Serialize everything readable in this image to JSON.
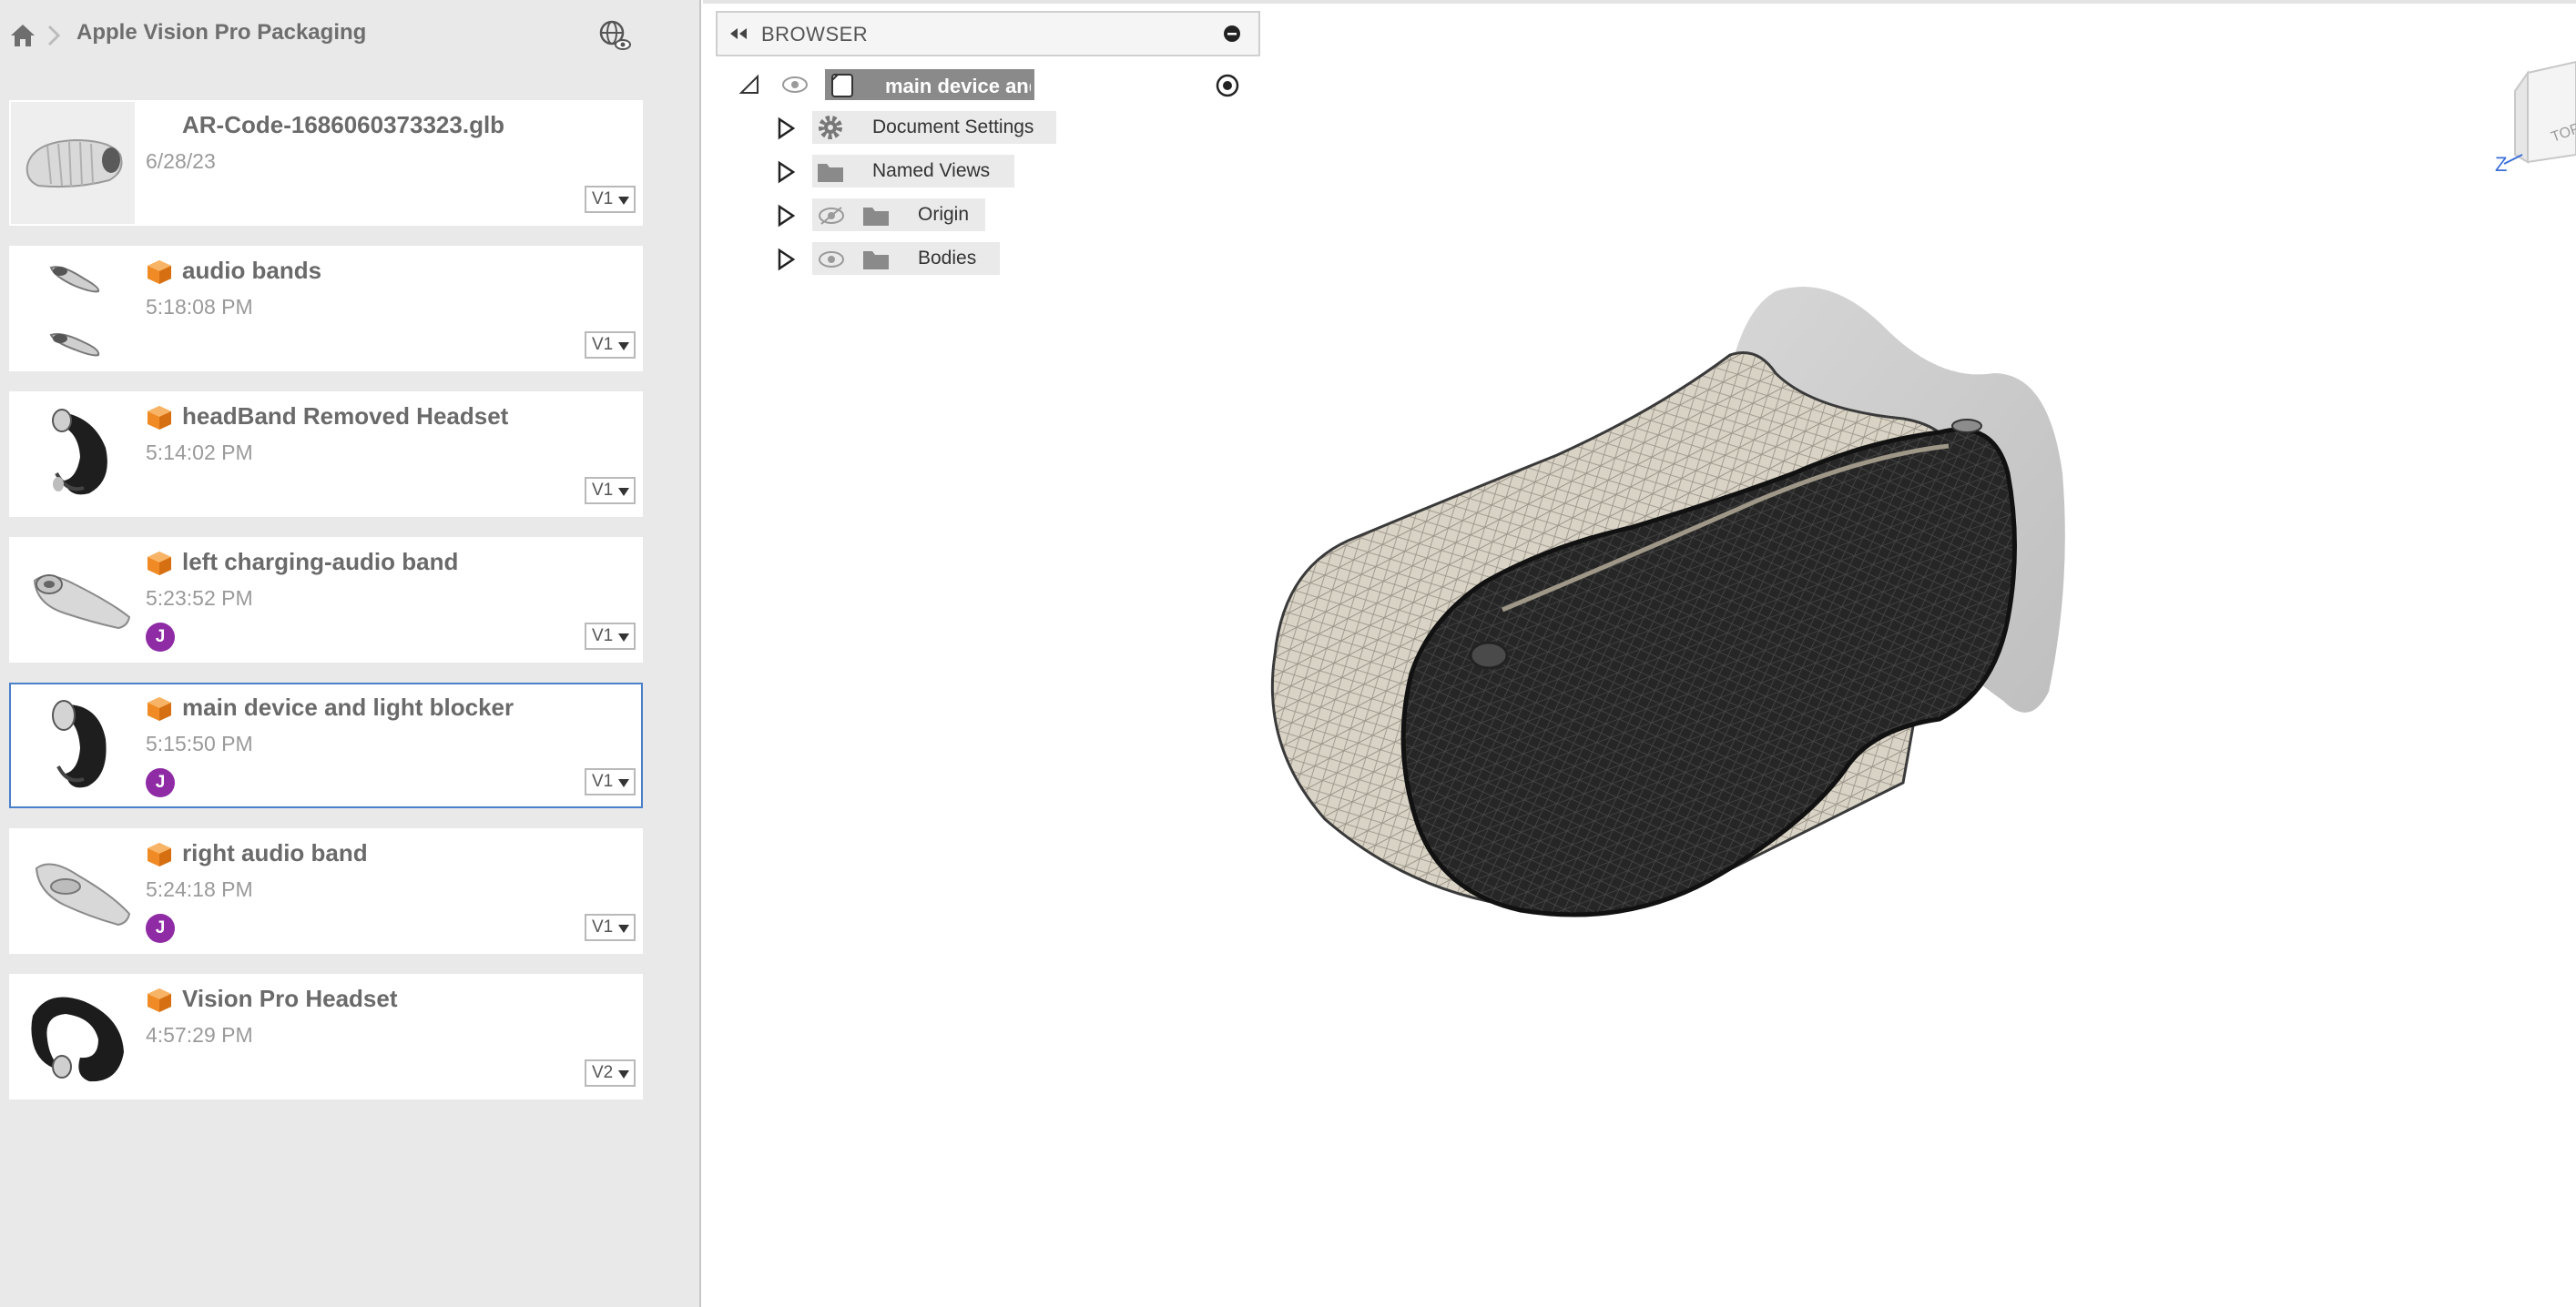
{
  "breadcrumb": {
    "title": "Apple Vision Pro Packaging"
  },
  "files": [
    {
      "name": "AR-Code-1686060373323.glb",
      "time": "6/28/23",
      "version": "V1",
      "has_avatar": false,
      "icon": "none"
    },
    {
      "name": "audio bands",
      "time": "5:18:08 PM",
      "version": "V1",
      "has_avatar": false,
      "icon": "cube-icon"
    },
    {
      "name": "headBand Removed Headset",
      "time": "5:14:02 PM",
      "version": "V1",
      "has_avatar": false,
      "icon": "cube-icon"
    },
    {
      "name": "left charging-audio band",
      "time": "5:23:52 PM",
      "version": "V1",
      "has_avatar": true,
      "avatar": "J",
      "icon": "cube-icon"
    },
    {
      "name": "main device and light blocker",
      "time": "5:15:50 PM",
      "version": "V1",
      "has_avatar": true,
      "avatar": "J",
      "icon": "cube-icon",
      "selected": true
    },
    {
      "name": "right audio band",
      "time": "5:24:18 PM",
      "version": "V1",
      "has_avatar": true,
      "avatar": "J",
      "icon": "cube-icon"
    },
    {
      "name": "Vision Pro Headset",
      "time": "4:57:29 PM",
      "version": "V2",
      "has_avatar": false,
      "icon": "cube-icon"
    }
  ],
  "browser": {
    "title": "BROWSER",
    "root": "main device and light blocker...",
    "nodes": [
      {
        "label": "Document Settings",
        "icon": "gear-icon"
      },
      {
        "label": "Named Views",
        "icon": "folder-icon"
      },
      {
        "label": "Origin",
        "icon": "folder-icon",
        "visibility": "hidden"
      },
      {
        "label": "Bodies",
        "icon": "folder-icon",
        "visibility": "visible"
      }
    ]
  },
  "viewcube": {
    "axis": "Z",
    "face": "TOP"
  },
  "colors": {
    "avatar": "#8e2ba5",
    "cube": "#f08a24",
    "selected_border": "#4a7fc9"
  }
}
